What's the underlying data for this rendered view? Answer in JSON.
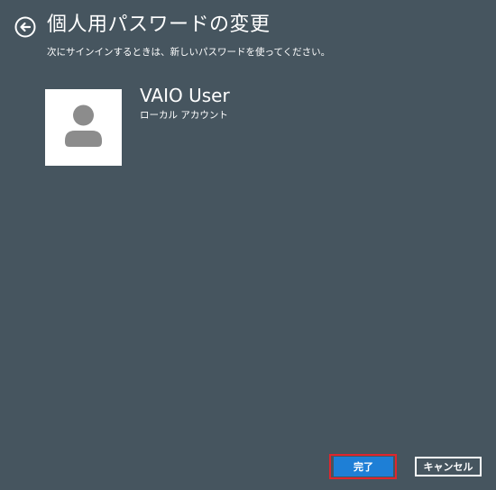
{
  "header": {
    "back_icon": "back-arrow-circle-icon",
    "title": "個人用パスワードの変更",
    "subtitle": "次にサインインするときは、新しいパスワードを使ってください。"
  },
  "account": {
    "avatar_icon": "user-avatar-icon",
    "name": "VAIO User",
    "type": "ローカル アカウント"
  },
  "buttons": {
    "done_label": "完了",
    "cancel_label": "キャンセル"
  },
  "colors": {
    "background": "#46555f",
    "accent": "#1e7fd6",
    "highlight": "#e0262d"
  }
}
